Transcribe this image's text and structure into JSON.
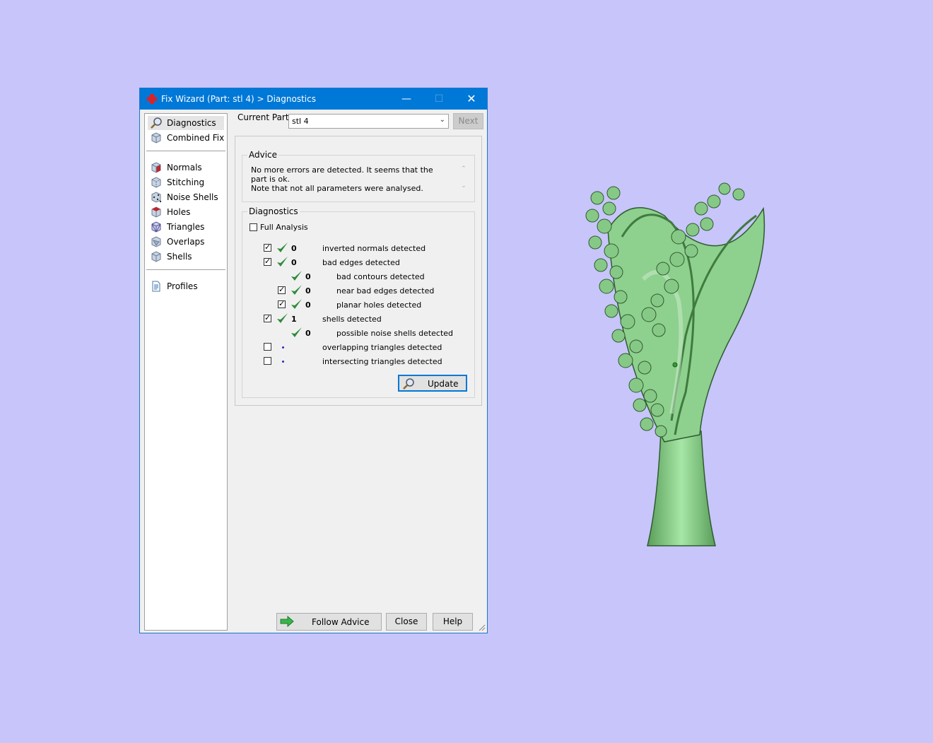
{
  "window": {
    "title": "Fix Wizard (Part: stl 4) > Diagnostics",
    "min_glyph": "—",
    "max_glyph": "☐",
    "close_glyph": "✕"
  },
  "sidebar": {
    "items": [
      {
        "label": "Diagnostics",
        "icon": "magnifier-icon"
      },
      {
        "label": "Combined Fix",
        "icon": "cube-icon"
      },
      {
        "label": "Normals",
        "icon": "normals-cube-icon"
      },
      {
        "label": "Stitching",
        "icon": "stitching-cube-icon"
      },
      {
        "label": "Noise Shells",
        "icon": "noise-shells-icon"
      },
      {
        "label": "Holes",
        "icon": "holes-cube-icon"
      },
      {
        "label": "Triangles",
        "icon": "triangles-cube-icon"
      },
      {
        "label": "Overlaps",
        "icon": "overlaps-cube-icon"
      },
      {
        "label": "Shells",
        "icon": "shells-cube-icon"
      },
      {
        "label": "Profiles",
        "icon": "document-icon"
      }
    ]
  },
  "header": {
    "current_part_label": "Current Part:",
    "current_part_value": "stl 4",
    "next_label": "Next"
  },
  "advice": {
    "title": "Advice",
    "line1": "No more errors are detected. It seems that the part is ok.",
    "line2": "Note that not all parameters were analysed."
  },
  "diagnostics": {
    "title": "Diagnostics",
    "full_analysis_label": "Full Analysis",
    "rows": [
      {
        "checked": true,
        "status": "ok",
        "count": "0",
        "label": "inverted normals detected"
      },
      {
        "checked": true,
        "status": "ok",
        "count": "0",
        "label": "bad edges detected"
      },
      {
        "checked": null,
        "status": "ok",
        "count": "0",
        "label": "bad contours detected"
      },
      {
        "checked": true,
        "status": "ok",
        "count": "0",
        "label": "near bad edges detected"
      },
      {
        "checked": true,
        "status": "ok",
        "count": "0",
        "label": "planar holes detected"
      },
      {
        "checked": true,
        "status": "ok",
        "count": "1",
        "label": "shells detected"
      },
      {
        "checked": null,
        "status": "ok",
        "count": "0",
        "label": "possible noise shells detected"
      },
      {
        "checked": false,
        "status": "not-analysed",
        "count": "",
        "label": "overlapping triangles detected"
      },
      {
        "checked": false,
        "status": "not-analysed",
        "count": "",
        "label": "intersecting triangles detected"
      }
    ],
    "update_label": "Update"
  },
  "footer": {
    "follow_advice_label": "Follow Advice",
    "close_label": "Close",
    "help_label": "Help"
  },
  "colors": {
    "desktop": "#c7c5fa",
    "titlebar": "#0078d7",
    "model_green": "#7fcf7f",
    "tick_green": "#2e8b3a"
  }
}
